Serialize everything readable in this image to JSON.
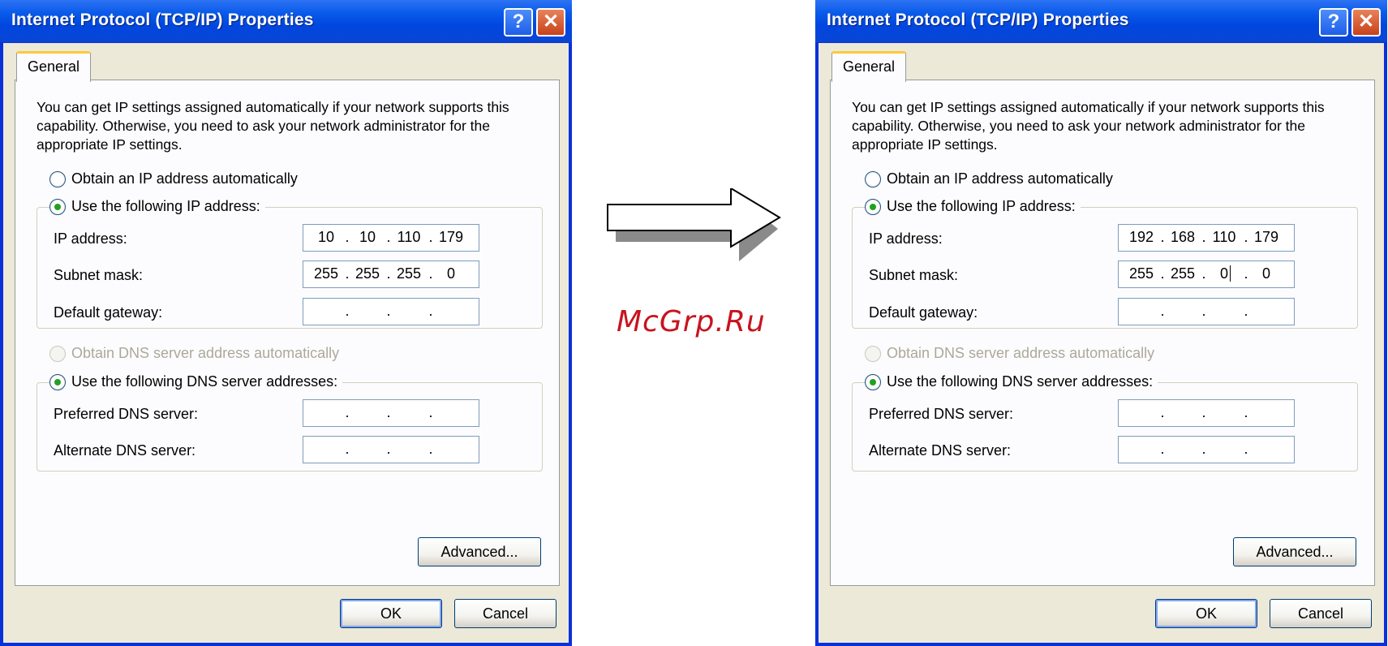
{
  "watermark": "McGrp.Ru",
  "dialogs": [
    {
      "title": "Internet Protocol (TCP/IP) Properties",
      "help_label": "?",
      "close_label": "✕",
      "tab": "General",
      "intro": "You can get IP settings assigned automatically if your network supports this capability. Otherwise, you need to ask your network administrator for the appropriate IP settings.",
      "radio_auto_ip": "Obtain an IP address automatically",
      "radio_manual_ip": "Use the following IP address:",
      "ip_label": "IP address:",
      "subnet_label": "Subnet mask:",
      "gateway_label": "Default gateway:",
      "ip_address": [
        "10",
        "10",
        "110",
        "179"
      ],
      "subnet_mask": [
        "255",
        "255",
        "255",
        "0"
      ],
      "default_gateway": [
        "",
        "",
        "",
        ""
      ],
      "radio_auto_dns": "Obtain DNS server address automatically",
      "radio_manual_dns": "Use the following DNS server addresses:",
      "preferred_dns_label": "Preferred DNS server:",
      "alternate_dns_label": "Alternate DNS server:",
      "preferred_dns": [
        "",
        "",
        "",
        ""
      ],
      "alternate_dns": [
        "",
        "",
        "",
        ""
      ],
      "dot": ".",
      "advanced_label": "Advanced...",
      "ok_label": "OK",
      "cancel_label": "Cancel"
    },
    {
      "title": "Internet Protocol (TCP/IP) Properties",
      "help_label": "?",
      "close_label": "✕",
      "tab": "General",
      "intro": "You can get IP settings assigned automatically if your network supports this capability. Otherwise, you need to ask your network administrator for the appropriate IP settings.",
      "radio_auto_ip": "Obtain an IP address automatically",
      "radio_manual_ip": "Use the following IP address:",
      "ip_label": "IP address:",
      "subnet_label": "Subnet mask:",
      "gateway_label": "Default gateway:",
      "ip_address": [
        "192",
        "168",
        "110",
        "179"
      ],
      "subnet_mask": [
        "255",
        "255",
        "0",
        "0"
      ],
      "default_gateway": [
        "",
        "",
        "",
        ""
      ],
      "radio_auto_dns": "Obtain DNS server address automatically",
      "radio_manual_dns": "Use the following DNS server addresses:",
      "preferred_dns_label": "Preferred DNS server:",
      "alternate_dns_label": "Alternate DNS server:",
      "preferred_dns": [
        "",
        "",
        "",
        ""
      ],
      "alternate_dns": [
        "",
        "",
        "",
        ""
      ],
      "dot": ".",
      "advanced_label": "Advanced...",
      "ok_label": "OK",
      "cancel_label": "Cancel"
    }
  ],
  "colors": {
    "titlebar": "#0A5BEA",
    "dialog_bg": "#ECE9D8",
    "radio_dot": "#21A121",
    "watermark": "#C8141E"
  }
}
